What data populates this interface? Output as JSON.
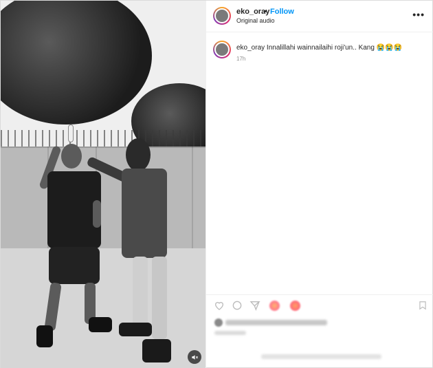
{
  "post": {
    "username": "eko_oray",
    "separator": "•",
    "follow_label": "Follow",
    "audio_label": "Original audio",
    "more_label": "•••"
  },
  "comment": {
    "username": "eko_oray",
    "text": "Innalillahi wainnailaihi roji'un.. Kang 😭😭😭",
    "time": "17h"
  },
  "icons": {
    "like": "heart-icon",
    "comment": "comment-icon",
    "share": "share-icon",
    "save": "bookmark-icon",
    "mute": "speaker-muted-icon"
  }
}
